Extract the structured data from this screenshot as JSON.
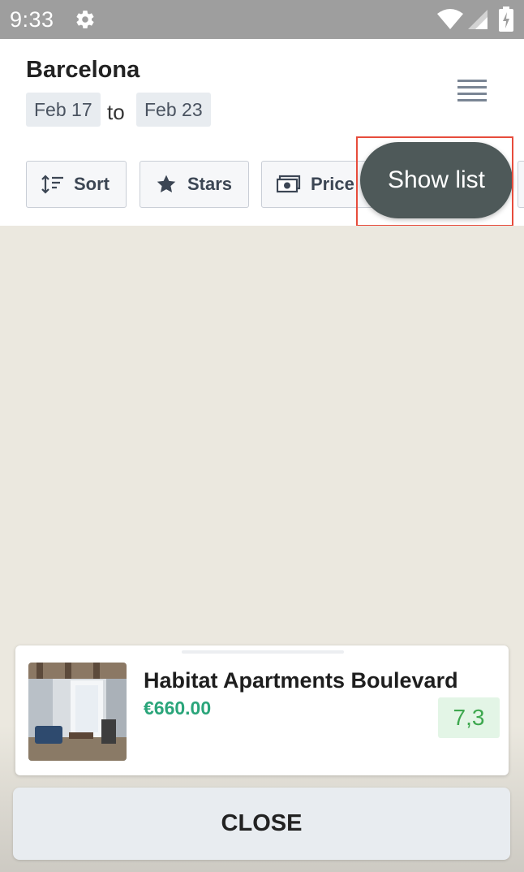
{
  "status_bar": {
    "time": "9:33",
    "icons": [
      "gear-icon",
      "wifi-icon",
      "signal-icon",
      "battery-charging-icon"
    ]
  },
  "header": {
    "city": "Barcelona",
    "date_from": "Feb 17",
    "date_separator": "to",
    "date_to": "Feb 23",
    "menu_icon": "hamburger-menu-icon"
  },
  "filters": {
    "sort_label": "Sort",
    "stars_label": "Stars",
    "price_label": "Price"
  },
  "show_list_label": "Show list",
  "hotel": {
    "name": "Habitat Apartments Boulevard",
    "price": "€660.00",
    "rating": "7,3"
  },
  "close_label": "CLOSE",
  "colors": {
    "accent_green": "#2aa57a",
    "rating_green": "#3ea84f",
    "show_list_bg": "#4e5959",
    "highlight_red": "#e74c3c"
  }
}
